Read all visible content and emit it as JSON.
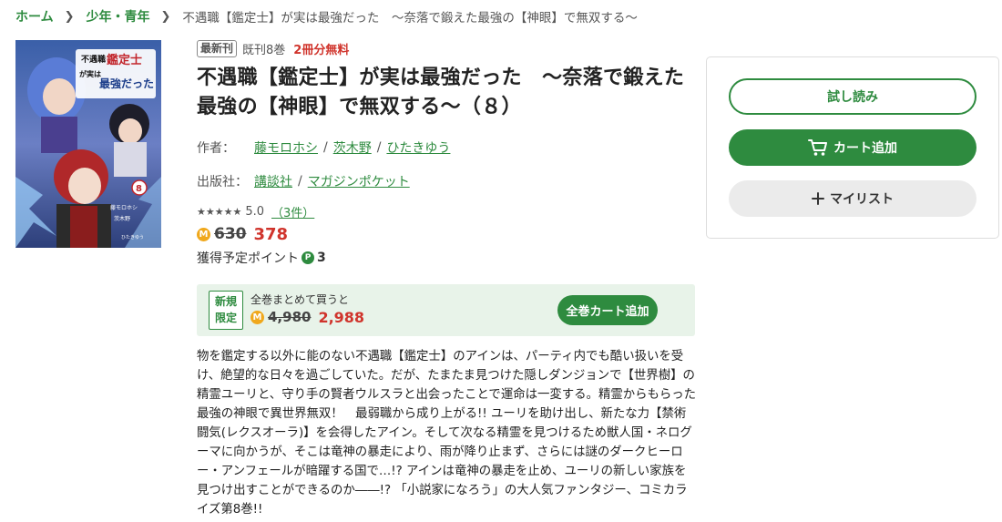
{
  "breadcrumb": {
    "home": "ホーム",
    "category": "少年・青年",
    "current": "不遇職【鑑定士】が実は最強だった　～奈落で鍛えた最強の【神眼】で無双する～"
  },
  "cover": {
    "title_line1": "不遇職",
    "title_line2": "鑑定士",
    "title_line3": "が実は",
    "title_line4": "最強だった",
    "volume": "8",
    "credit1": "藤モロホシ",
    "credit2": "茨木野",
    "credit3": "ひたきゆう"
  },
  "badges": {
    "newest": "最新刊",
    "volumes": "既刊8巻",
    "free": "2冊分無料"
  },
  "title": "不遇職【鑑定士】が実は最強だった　～奈落で鍛えた最強の【神眼】で無双する～（８）",
  "authors": {
    "label": "作者：",
    "names": [
      "藤モロホシ",
      "茨木野",
      "ひたきゆう"
    ]
  },
  "publisher": {
    "label": "出版社：",
    "names": [
      "講談社",
      "マガジンポケット"
    ]
  },
  "rating": {
    "stars": "★★★★★",
    "score": "5.0",
    "count": "（3件）"
  },
  "price": {
    "coin": "M",
    "original": "630",
    "sale": "378"
  },
  "points": {
    "label": "獲得予定ポイント",
    "icon": "P",
    "value": "3"
  },
  "bundle": {
    "tag_line1": "新規",
    "tag_line2": "限定",
    "text": "全巻まとめて買うと",
    "coin": "M",
    "original": "4,980",
    "sale": "2,988",
    "button": "全巻カート追加"
  },
  "description": "物を鑑定する以外に能のない不遇職【鑑定士】のアインは、パーティ内でも酷い扱いを受け、絶望的な日々を過ごしていた。だが、たまたま見つけた隠しダンジョンで【世界樹】の精霊ユーリと、守り手の賢者ウルスラと出会ったことで運命は一変する。精霊からもらった最強の神眼で異世界無双！　最弱職から成り上がる!! ユーリを助け出し、新たな力【禁術闘気(レクスオーラ)】を会得したアイン。そして次なる精霊を見つけるため獣人国・ネログーマに向かうが、そこは竜神の暴走により、雨が降り止まず、さらには謎のダークヒーロー・アンフェールが暗躍する国で…!? アインは竜神の暴走を止め、ユーリの新しい家族を見つけ出すことができるのか――!? 「小説家になろう」の大人気ファンタジー、コミカライズ第8巻!!",
  "panel": {
    "trial": "試し読み",
    "cart": "カート追加",
    "mylist": "マイリスト"
  },
  "colors": {
    "accent": "#2e8b3f",
    "sale": "#d0342c",
    "coin": "#f0a81c"
  }
}
